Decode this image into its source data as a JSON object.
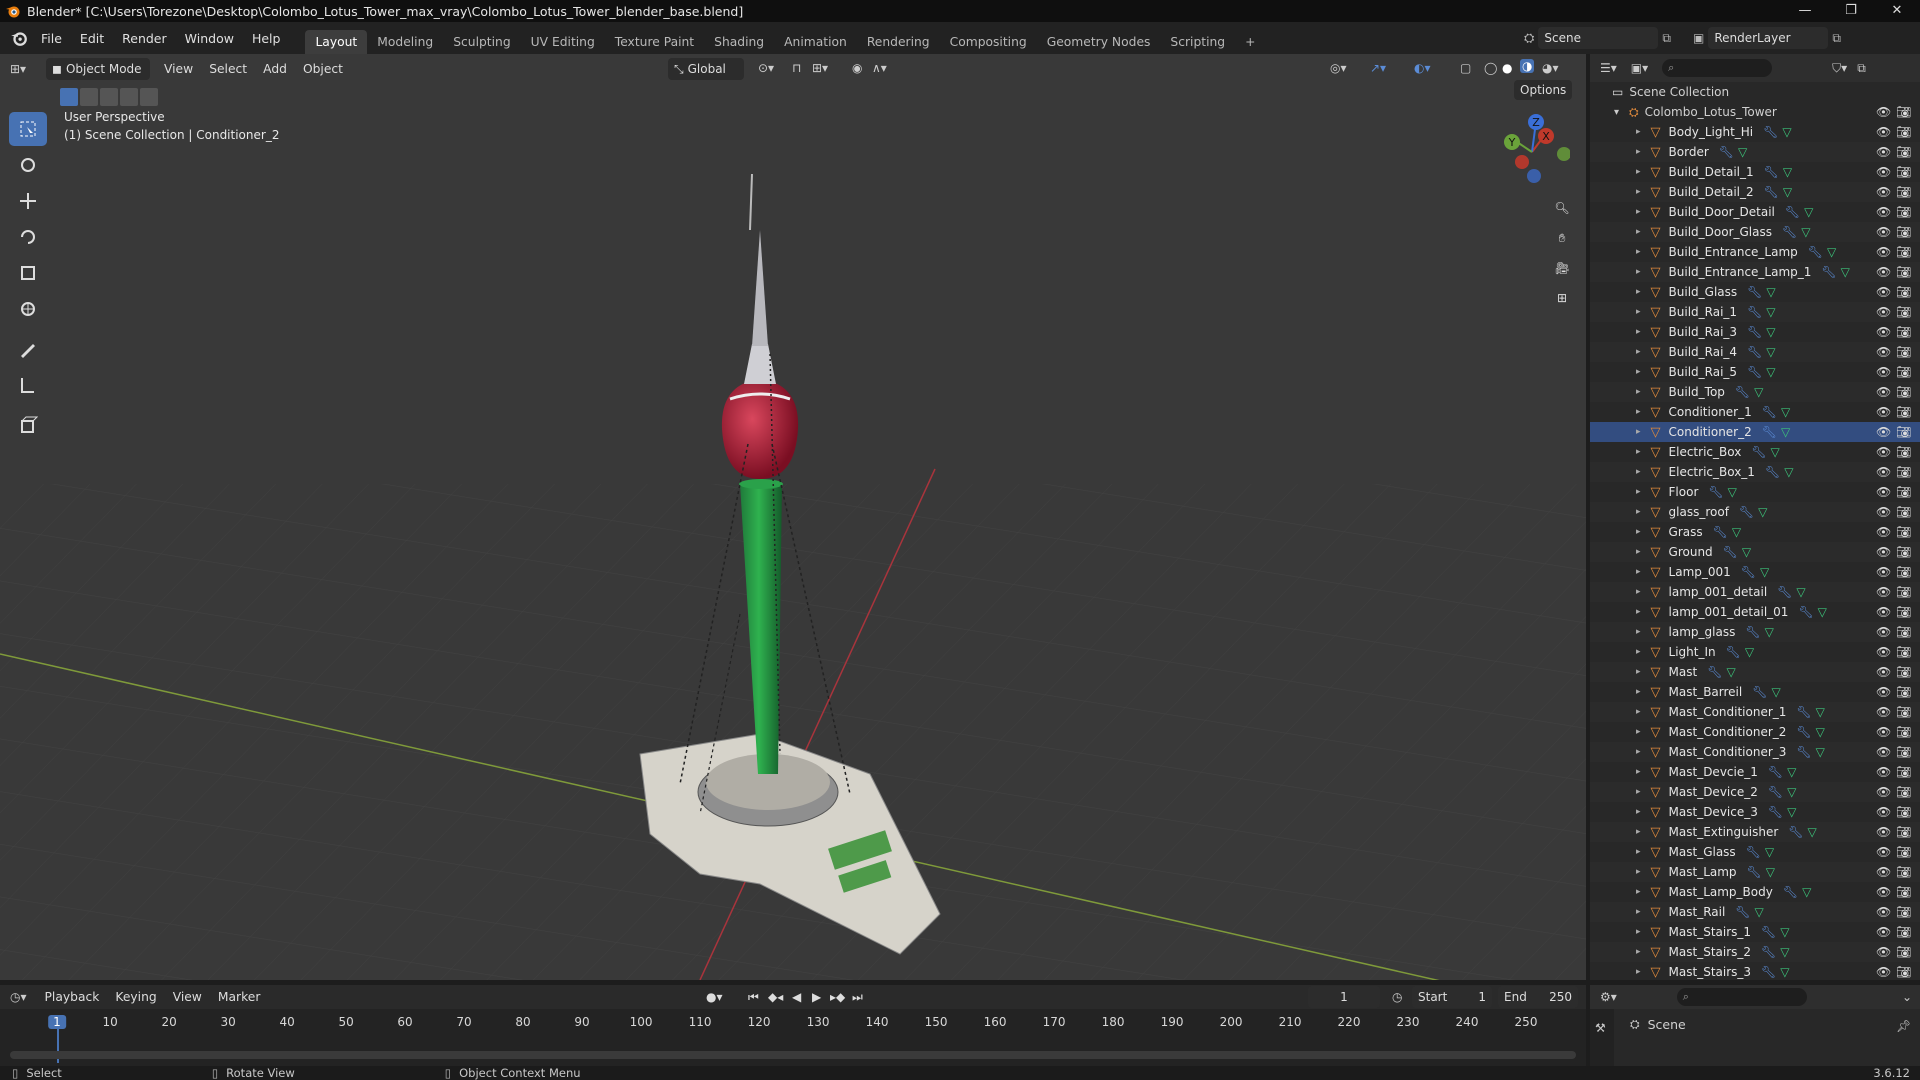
{
  "window": {
    "title": "Blender* [C:\\Users\\Torezone\\Desktop\\Colombo_Lotus_Tower_max_vray\\Colombo_Lotus_Tower_blender_base.blend]",
    "controls": [
      "—",
      "❐",
      "✕"
    ]
  },
  "menu": [
    "File",
    "Edit",
    "Render",
    "Window",
    "Help"
  ],
  "workspaces": [
    "Layout",
    "Modeling",
    "Sculpting",
    "UV Editing",
    "Texture Paint",
    "Shading",
    "Animation",
    "Rendering",
    "Compositing",
    "Geometry Nodes",
    "Scripting",
    "+"
  ],
  "active_workspace": "Layout",
  "scene": {
    "name": "Scene",
    "render_layer": "RenderLayer"
  },
  "viewport": {
    "mode": "Object Mode",
    "menus": [
      "View",
      "Select",
      "Add",
      "Object"
    ],
    "transform_orientation": "Global",
    "options_label": "Options",
    "overlay_title": "User Perspective",
    "overlay_subtitle": "(1) Scene Collection | Conditioner_2",
    "gizmo": {
      "x": "X",
      "y": "Y",
      "z": "Z"
    }
  },
  "outliner": {
    "root": "Scene Collection",
    "collection": "Colombo_Lotus_Tower",
    "selected": "Conditioner_2",
    "objects": [
      "Body_Light_Hi",
      "Border",
      "Build_Detail_1",
      "Build_Detail_2",
      "Build_Door_Detail",
      "Build_Door_Glass",
      "Build_Entrance_Lamp",
      "Build_Entrance_Lamp_1",
      "Build_Glass",
      "Build_Rai_1",
      "Build_Rai_3",
      "Build_Rai_4",
      "Build_Rai_5",
      "Build_Top",
      "Conditioner_1",
      "Conditioner_2",
      "Electric_Box",
      "Electric_Box_1",
      "Floor",
      "glass_roof",
      "Grass",
      "Ground",
      "Lamp_001",
      "lamp_001_detail",
      "lamp_001_detail_01",
      "lamp_glass",
      "Light_In",
      "Mast",
      "Mast_Barreil",
      "Mast_Conditioner_1",
      "Mast_Conditioner_2",
      "Mast_Conditioner_3",
      "Mast_Devcie_1",
      "Mast_Device_2",
      "Mast_Device_3",
      "Mast_Extinguisher",
      "Mast_Glass",
      "Mast_Lamp",
      "Mast_Lamp_Body",
      "Mast_Rail",
      "Mast_Stairs_1",
      "Mast_Stairs_2",
      "Mast_Stairs_3"
    ]
  },
  "timeline": {
    "menus": [
      "Playback",
      "Keying",
      "View",
      "Marker"
    ],
    "current_frame": "1",
    "start_label": "Start",
    "start": "1",
    "end_label": "End",
    "end": "250",
    "ticks": [
      "1",
      "10",
      "20",
      "30",
      "40",
      "50",
      "60",
      "70",
      "80",
      "90",
      "100",
      "110",
      "120",
      "130",
      "140",
      "150",
      "160",
      "170",
      "180",
      "190",
      "200",
      "210",
      "220",
      "230",
      "240",
      "250"
    ]
  },
  "properties": {
    "scene_label": "Scene"
  },
  "statusbar": {
    "select": "Select",
    "rotate": "Rotate View",
    "context": "Object Context Menu",
    "version": "3.6.12"
  },
  "colors": {
    "accent": "#4772b3",
    "object_icon": "#e08a3c",
    "modifier_icon": "#5b8cd6",
    "mesh_icon": "#3cc37a"
  }
}
